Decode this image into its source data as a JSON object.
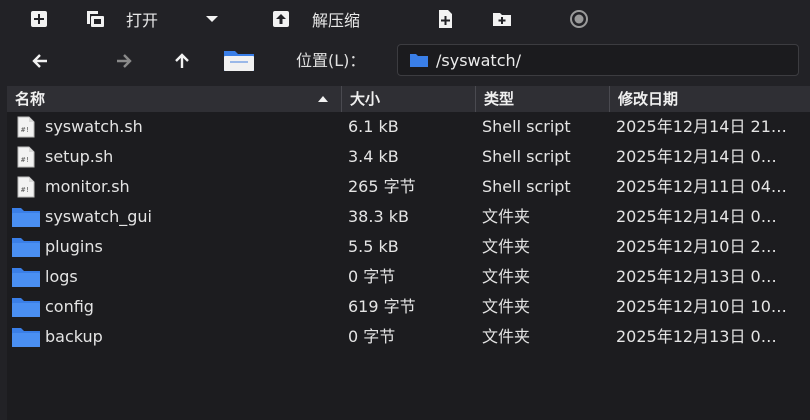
{
  "toolbar": {
    "open_label": "打开",
    "extract_label": "解压缩"
  },
  "nav": {
    "location_label": "位置(L)：",
    "path": "/syswatch/"
  },
  "columns": {
    "name": "名称",
    "size": "大小",
    "type": "类型",
    "modified": "修改日期"
  },
  "files": [
    {
      "name": "syswatch.sh",
      "size": "6.1 kB",
      "type": "Shell script",
      "modified": "2025年12月14日 21…",
      "icon": "script-file-icon"
    },
    {
      "name": "setup.sh",
      "size": "3.4 kB",
      "type": "Shell script",
      "modified": "2025年12月14日 0…",
      "icon": "script-file-icon"
    },
    {
      "name": "monitor.sh",
      "size": "265 字节",
      "type": "Shell script",
      "modified": "2025年12月11日 04…",
      "icon": "script-file-icon"
    },
    {
      "name": "syswatch_gui",
      "size": "38.3 kB",
      "type": "文件夹",
      "modified": "2025年12月14日 0…",
      "icon": "folder-icon"
    },
    {
      "name": "plugins",
      "size": "5.5 kB",
      "type": "文件夹",
      "modified": "2025年12月10日 2…",
      "icon": "folder-icon"
    },
    {
      "name": "logs",
      "size": "0 字节",
      "type": "文件夹",
      "modified": "2025年12月13日 0…",
      "icon": "folder-icon"
    },
    {
      "name": "config",
      "size": "619 字节",
      "type": "文件夹",
      "modified": "2025年12月10日 10…",
      "icon": "folder-icon"
    },
    {
      "name": "backup",
      "size": "0 字节",
      "type": "文件夹",
      "modified": "2025年12月13日 0…",
      "icon": "folder-icon"
    }
  ],
  "colors": {
    "folder": "#3a7fe8",
    "background": "#222226",
    "list_background": "#1c1c1f"
  }
}
